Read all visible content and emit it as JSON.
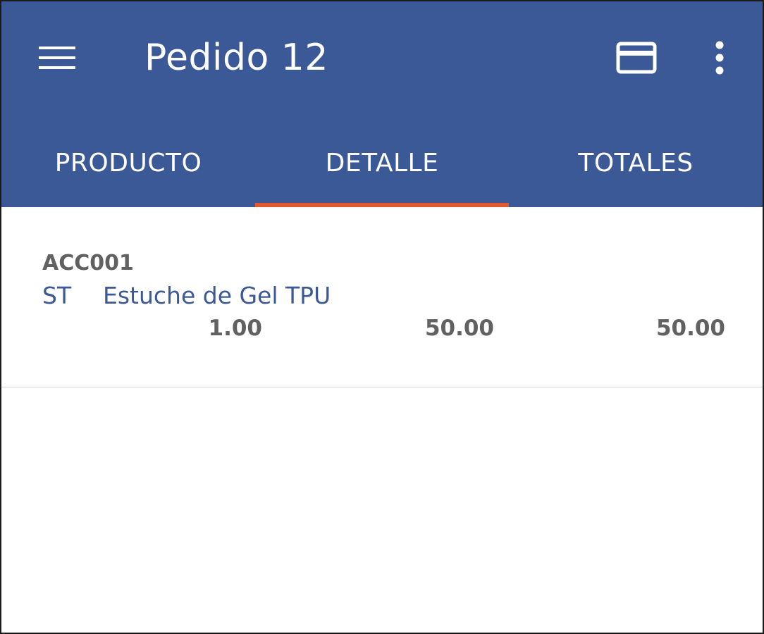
{
  "appbar": {
    "title": "Pedido 12",
    "background": "#3c5997",
    "icons": {
      "menu": "menu-icon",
      "payment": "credit-card-icon",
      "more": "more-vert-icon"
    }
  },
  "tabs": [
    {
      "label": "PRODUCTO",
      "selected": false
    },
    {
      "label": "DETALLE",
      "selected": true
    },
    {
      "label": "TOTALES",
      "selected": false
    }
  ],
  "indicator_color": "#e5582e",
  "items": [
    {
      "code": "ACC001",
      "unit": "ST",
      "description": "Estuche de Gel TPU",
      "quantity": "1.00",
      "price": "50.00",
      "total": "50.00"
    }
  ]
}
